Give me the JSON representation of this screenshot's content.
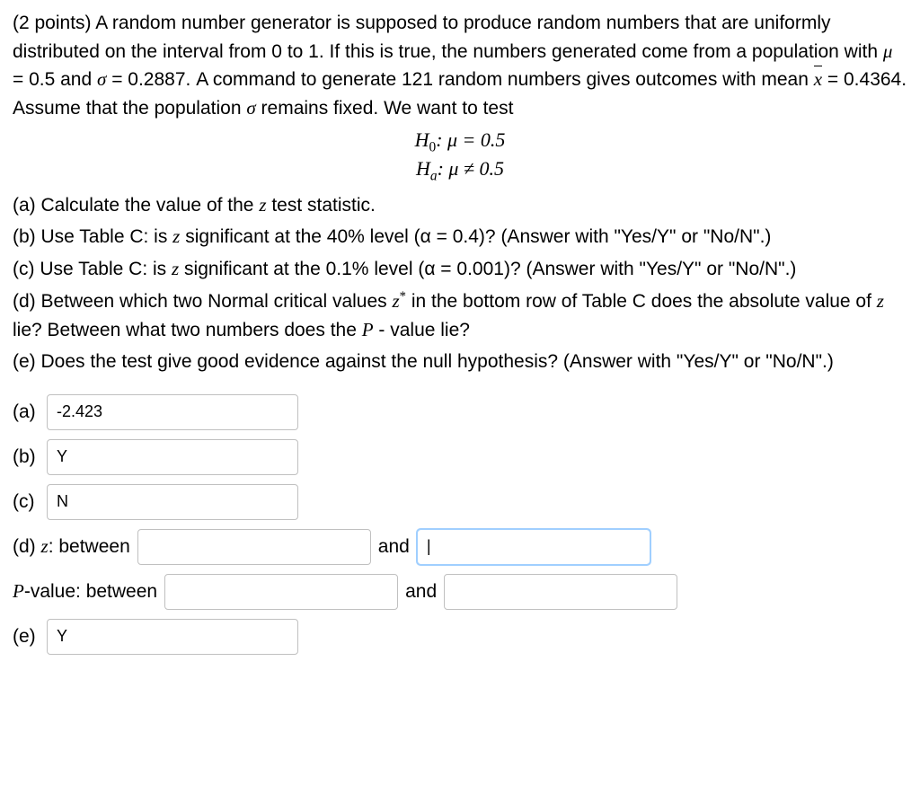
{
  "question": {
    "intro_1": "(2 points) A random number generator is supposed to produce random numbers that are uniformly distributed on the interval from 0 to 1. If this is true, the numbers generated come from a population with ",
    "mu": "μ",
    "eq_mu": " = 0.5 and ",
    "sigma": "σ",
    "eq_sigma": " = 0.2887. A command to generate 121 random numbers gives outcomes with mean ",
    "xbar": "x",
    "eq_xbar": " = 0.4364. Assume that the population ",
    "sigma2": "σ",
    "remains": " remains fixed. We want to test",
    "h0_left": "H",
    "h0_sub": "0",
    "h0_text": ": μ = 0.5",
    "ha_left": "H",
    "ha_sub": "a",
    "ha_text": ": μ ≠ 0.5",
    "part_a": "(a) Calculate the value of the ",
    "z_stat": "z",
    "part_a_end": " test statistic.",
    "part_b": "(b) Use Table C: is ",
    "part_b_end": " significant at the 40% level (α = 0.4)? (Answer with \"Yes/Y\" or \"No/N\".)",
    "part_c": "(c) Use Table C: is ",
    "part_c_end": " significant at the 0.1% level (α = 0.001)? (Answer with \"Yes/Y\" or \"No/N\".)",
    "part_d_1": "(d) Between which two Normal critical values ",
    "z_star": "z",
    "star": "*",
    "part_d_2": " in the bottom row of Table C does the absolute value of ",
    "part_d_3": " lie? Between what two numbers does the ",
    "p_letter": "P",
    "part_d_4": " - value lie?",
    "part_e": "(e) Does the test give good evidence against the null hypothesis? (Answer with \"Yes/Y\" or \"No/N\".)"
  },
  "answers": {
    "a_label": "(a)",
    "a_value": "-2.423",
    "b_label": "(b)",
    "b_value": "Y",
    "c_label": "(c)",
    "c_value": "N",
    "d_label": "(d) ",
    "d_z_label": "z",
    "d_between": ": between",
    "d_z1": "",
    "d_and": "and",
    "d_z2": "|",
    "p_label_italic": "P",
    "p_label_rest": "-value: between",
    "p1": "",
    "p_and": "and",
    "p2": "",
    "e_label": "(e)",
    "e_value": "Y"
  }
}
